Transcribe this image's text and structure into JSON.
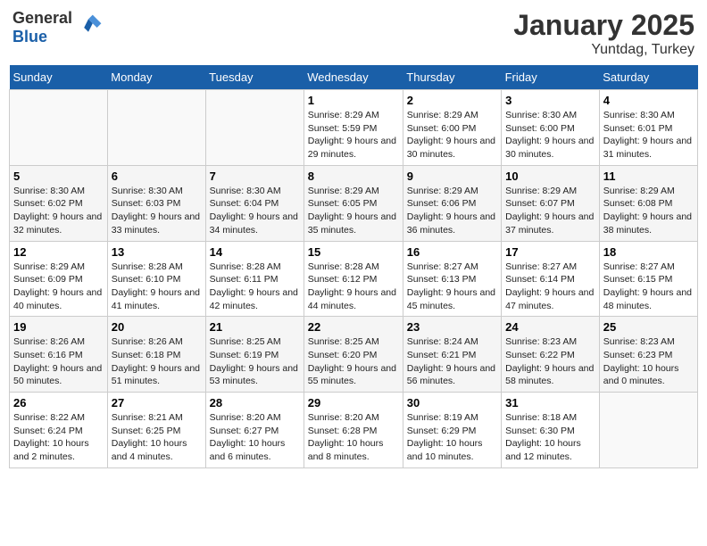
{
  "header": {
    "logo_general": "General",
    "logo_blue": "Blue",
    "title": "January 2025",
    "subtitle": "Yuntdag, Turkey"
  },
  "days_of_week": [
    "Sunday",
    "Monday",
    "Tuesday",
    "Wednesday",
    "Thursday",
    "Friday",
    "Saturday"
  ],
  "weeks": [
    [
      {
        "day": "",
        "content": ""
      },
      {
        "day": "",
        "content": ""
      },
      {
        "day": "",
        "content": ""
      },
      {
        "day": "1",
        "content": "Sunrise: 8:29 AM\nSunset: 5:59 PM\nDaylight: 9 hours and 29 minutes."
      },
      {
        "day": "2",
        "content": "Sunrise: 8:29 AM\nSunset: 6:00 PM\nDaylight: 9 hours and 30 minutes."
      },
      {
        "day": "3",
        "content": "Sunrise: 8:30 AM\nSunset: 6:00 PM\nDaylight: 9 hours and 30 minutes."
      },
      {
        "day": "4",
        "content": "Sunrise: 8:30 AM\nSunset: 6:01 PM\nDaylight: 9 hours and 31 minutes."
      }
    ],
    [
      {
        "day": "5",
        "content": "Sunrise: 8:30 AM\nSunset: 6:02 PM\nDaylight: 9 hours and 32 minutes."
      },
      {
        "day": "6",
        "content": "Sunrise: 8:30 AM\nSunset: 6:03 PM\nDaylight: 9 hours and 33 minutes."
      },
      {
        "day": "7",
        "content": "Sunrise: 8:30 AM\nSunset: 6:04 PM\nDaylight: 9 hours and 34 minutes."
      },
      {
        "day": "8",
        "content": "Sunrise: 8:29 AM\nSunset: 6:05 PM\nDaylight: 9 hours and 35 minutes."
      },
      {
        "day": "9",
        "content": "Sunrise: 8:29 AM\nSunset: 6:06 PM\nDaylight: 9 hours and 36 minutes."
      },
      {
        "day": "10",
        "content": "Sunrise: 8:29 AM\nSunset: 6:07 PM\nDaylight: 9 hours and 37 minutes."
      },
      {
        "day": "11",
        "content": "Sunrise: 8:29 AM\nSunset: 6:08 PM\nDaylight: 9 hours and 38 minutes."
      }
    ],
    [
      {
        "day": "12",
        "content": "Sunrise: 8:29 AM\nSunset: 6:09 PM\nDaylight: 9 hours and 40 minutes."
      },
      {
        "day": "13",
        "content": "Sunrise: 8:28 AM\nSunset: 6:10 PM\nDaylight: 9 hours and 41 minutes."
      },
      {
        "day": "14",
        "content": "Sunrise: 8:28 AM\nSunset: 6:11 PM\nDaylight: 9 hours and 42 minutes."
      },
      {
        "day": "15",
        "content": "Sunrise: 8:28 AM\nSunset: 6:12 PM\nDaylight: 9 hours and 44 minutes."
      },
      {
        "day": "16",
        "content": "Sunrise: 8:27 AM\nSunset: 6:13 PM\nDaylight: 9 hours and 45 minutes."
      },
      {
        "day": "17",
        "content": "Sunrise: 8:27 AM\nSunset: 6:14 PM\nDaylight: 9 hours and 47 minutes."
      },
      {
        "day": "18",
        "content": "Sunrise: 8:27 AM\nSunset: 6:15 PM\nDaylight: 9 hours and 48 minutes."
      }
    ],
    [
      {
        "day": "19",
        "content": "Sunrise: 8:26 AM\nSunset: 6:16 PM\nDaylight: 9 hours and 50 minutes."
      },
      {
        "day": "20",
        "content": "Sunrise: 8:26 AM\nSunset: 6:18 PM\nDaylight: 9 hours and 51 minutes."
      },
      {
        "day": "21",
        "content": "Sunrise: 8:25 AM\nSunset: 6:19 PM\nDaylight: 9 hours and 53 minutes."
      },
      {
        "day": "22",
        "content": "Sunrise: 8:25 AM\nSunset: 6:20 PM\nDaylight: 9 hours and 55 minutes."
      },
      {
        "day": "23",
        "content": "Sunrise: 8:24 AM\nSunset: 6:21 PM\nDaylight: 9 hours and 56 minutes."
      },
      {
        "day": "24",
        "content": "Sunrise: 8:23 AM\nSunset: 6:22 PM\nDaylight: 9 hours and 58 minutes."
      },
      {
        "day": "25",
        "content": "Sunrise: 8:23 AM\nSunset: 6:23 PM\nDaylight: 10 hours and 0 minutes."
      }
    ],
    [
      {
        "day": "26",
        "content": "Sunrise: 8:22 AM\nSunset: 6:24 PM\nDaylight: 10 hours and 2 minutes."
      },
      {
        "day": "27",
        "content": "Sunrise: 8:21 AM\nSunset: 6:25 PM\nDaylight: 10 hours and 4 minutes."
      },
      {
        "day": "28",
        "content": "Sunrise: 8:20 AM\nSunset: 6:27 PM\nDaylight: 10 hours and 6 minutes."
      },
      {
        "day": "29",
        "content": "Sunrise: 8:20 AM\nSunset: 6:28 PM\nDaylight: 10 hours and 8 minutes."
      },
      {
        "day": "30",
        "content": "Sunrise: 8:19 AM\nSunset: 6:29 PM\nDaylight: 10 hours and 10 minutes."
      },
      {
        "day": "31",
        "content": "Sunrise: 8:18 AM\nSunset: 6:30 PM\nDaylight: 10 hours and 12 minutes."
      },
      {
        "day": "",
        "content": ""
      }
    ]
  ]
}
